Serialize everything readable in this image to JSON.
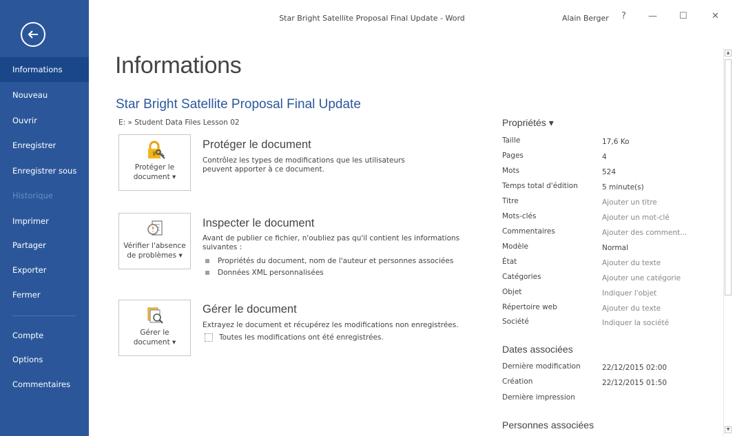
{
  "window": {
    "title": "Star Bright Satellite Proposal Final Update - Word",
    "user": "Alain Berger",
    "help": "?",
    "minimize": "—",
    "maximize": "☐",
    "close": "✕"
  },
  "sidebar": {
    "items": [
      {
        "label": "Informations",
        "state": "active"
      },
      {
        "label": "Nouveau"
      },
      {
        "label": "Ouvrir"
      },
      {
        "label": "Enregistrer"
      },
      {
        "label": "Enregistrer sous"
      },
      {
        "label": "Historique",
        "state": "disabled"
      },
      {
        "label": "Imprimer"
      },
      {
        "label": "Partager"
      },
      {
        "label": "Exporter"
      },
      {
        "label": "Fermer"
      },
      {
        "label": "Compte"
      },
      {
        "label": "Options"
      },
      {
        "label": "Commentaires"
      }
    ]
  },
  "main": {
    "heading": "Informations",
    "doc_title": "Star Bright Satellite Proposal Final Update",
    "doc_path": "E: » Student Data Files Lesson 02",
    "protect": {
      "button_line1": "Protéger le",
      "button_line2": "document ▾",
      "title": "Protéger le document",
      "desc": "Contrôlez les types de modifications que les utilisateurs peuvent apporter à ce document."
    },
    "inspect": {
      "button_line1": "Vérifier l'absence",
      "button_line2": "de problèmes ▾",
      "title": "Inspecter le document",
      "desc": "Avant de publier ce fichier, n'oubliez pas qu'il contient les informations suivantes :",
      "bullets": [
        "Propriétés du document, nom de l'auteur et personnes associées",
        "Données XML personnalisées"
      ]
    },
    "manage": {
      "button_line1": "Gérer le",
      "button_line2": "document ▾",
      "title": "Gérer le document",
      "desc": "Extrayez le document et récupérez les modifications non enregistrées.",
      "saved": "Toutes les modifications ont été enregistrées."
    }
  },
  "properties": {
    "heading": "Propriétés ▾",
    "rows": [
      {
        "key": "Taille",
        "value": "17,6 Ko"
      },
      {
        "key": "Pages",
        "value": "4"
      },
      {
        "key": "Mots",
        "value": "524"
      },
      {
        "key": "Temps total d'édition",
        "value": "5 minute(s)"
      },
      {
        "key": "Titre",
        "value": "Ajouter un titre",
        "placeholder": true
      },
      {
        "key": "Mots-clés",
        "value": "Ajouter un mot-clé",
        "placeholder": true
      },
      {
        "key": "Commentaires",
        "value": "Ajouter des comment...",
        "placeholder": true
      },
      {
        "key": "Modèle",
        "value": "Normal"
      },
      {
        "key": "État",
        "value": "Ajouter du texte",
        "placeholder": true
      },
      {
        "key": "Catégories",
        "value": "Ajouter une catégorie",
        "placeholder": true
      },
      {
        "key": "Objet",
        "value": "Indiquer l'objet",
        "placeholder": true
      },
      {
        "key": "Répertoire web",
        "value": "Ajouter du texte",
        "placeholder": true
      },
      {
        "key": "Société",
        "value": "Indiquer la société",
        "placeholder": true
      }
    ],
    "dates_heading": "Dates associées",
    "dates": [
      {
        "key": "Dernière modification",
        "value": "22/12/2015 02:00"
      },
      {
        "key": "Création",
        "value": "22/12/2015 01:50"
      },
      {
        "key": "Dernière impression",
        "value": ""
      }
    ],
    "people_heading": "Personnes associées"
  },
  "icons": {
    "back": "back-arrow-icon",
    "protect": "lock-key-icon",
    "inspect": "inspect-document-icon",
    "manage": "manage-document-icon",
    "saved": "saved-document-icon"
  },
  "colors": {
    "sidebar": "#2b579a",
    "sidebar_active": "#19478a",
    "accent": "#2b579a"
  }
}
